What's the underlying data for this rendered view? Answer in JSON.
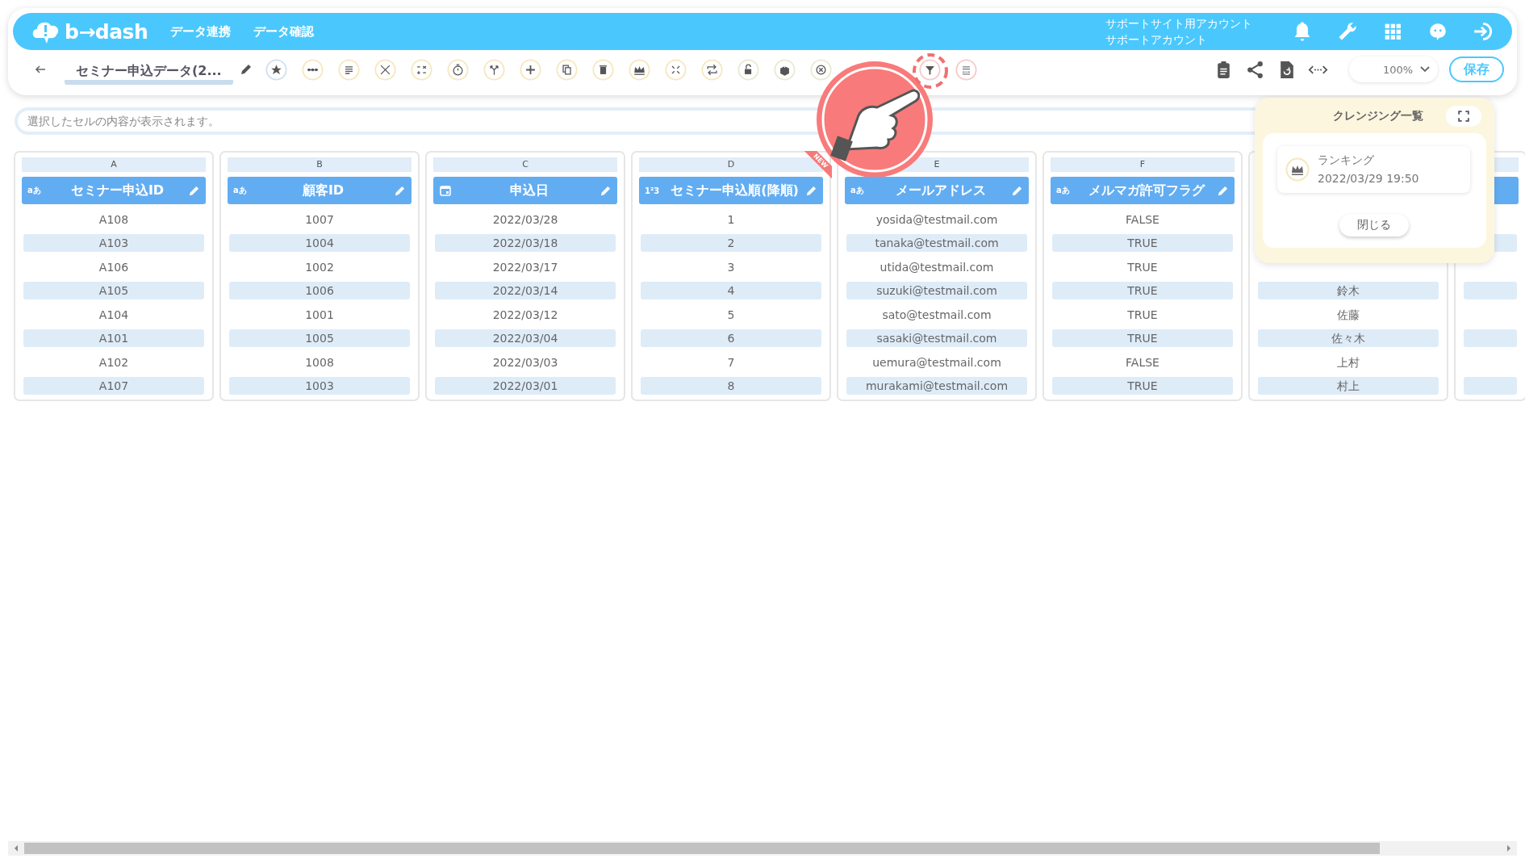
{
  "header": {
    "logo": "b→dash",
    "nav": [
      "データ連携",
      "データ確認"
    ],
    "account": [
      "サポートサイト用アカウント",
      "サポートアカウント"
    ]
  },
  "toolbar": {
    "title": "セミナー申込データ(2...",
    "zoom": "100%",
    "save": "保存"
  },
  "cell_field": {
    "placeholder": "選択したセルの内容が表示されます。"
  },
  "columns": [
    {
      "letter": "A",
      "name": "セミナー申込ID",
      "kind": "text",
      "badge": "aあ",
      "cells": [
        "A108",
        "A103",
        "A106",
        "A105",
        "A104",
        "A101",
        "A102",
        "A107"
      ]
    },
    {
      "letter": "B",
      "name": "顧客ID",
      "kind": "text",
      "badge": "aあ",
      "cells": [
        "1007",
        "1004",
        "1002",
        "1006",
        "1001",
        "1005",
        "1008",
        "1003"
      ]
    },
    {
      "letter": "C",
      "name": "申込日",
      "kind": "date",
      "cells": [
        "2022/03/28",
        "2022/03/18",
        "2022/03/17",
        "2022/03/14",
        "2022/03/12",
        "2022/03/04",
        "2022/03/03",
        "2022/03/01"
      ]
    },
    {
      "letter": "D",
      "name": "セミナー申込順(降順)",
      "kind": "number",
      "badge": "1²3",
      "new_label": "NEW",
      "cells": [
        "1",
        "2",
        "3",
        "4",
        "5",
        "6",
        "7",
        "8"
      ]
    },
    {
      "letter": "E",
      "name": "メールアドレス",
      "kind": "text",
      "badge": "aあ",
      "cells": [
        "yosida@testmail.com",
        "tanaka@testmail.com",
        "utida@testmail.com",
        "suzuki@testmail.com",
        "sato@testmail.com",
        "sasaki@testmail.com",
        "uemura@testmail.com",
        "murakami@testmail.com"
      ]
    },
    {
      "letter": "F",
      "name": "メルマガ許可フラグ",
      "kind": "text",
      "badge": "aあ",
      "cells": [
        "FALSE",
        "TRUE",
        "TRUE",
        "TRUE",
        "TRUE",
        "TRUE",
        "FALSE",
        "TRUE"
      ]
    },
    {
      "kind": "hidden",
      "cells": [
        "鈴木",
        "佐藤",
        "佐々木",
        "上村",
        "村上"
      ]
    },
    {
      "kind": "hidden"
    }
  ],
  "cleansing_panel": {
    "title": "クレンジング一覧",
    "items": [
      {
        "name": "ランキング",
        "time": "2022/03/29 19:50"
      }
    ],
    "close": "閉じる"
  }
}
